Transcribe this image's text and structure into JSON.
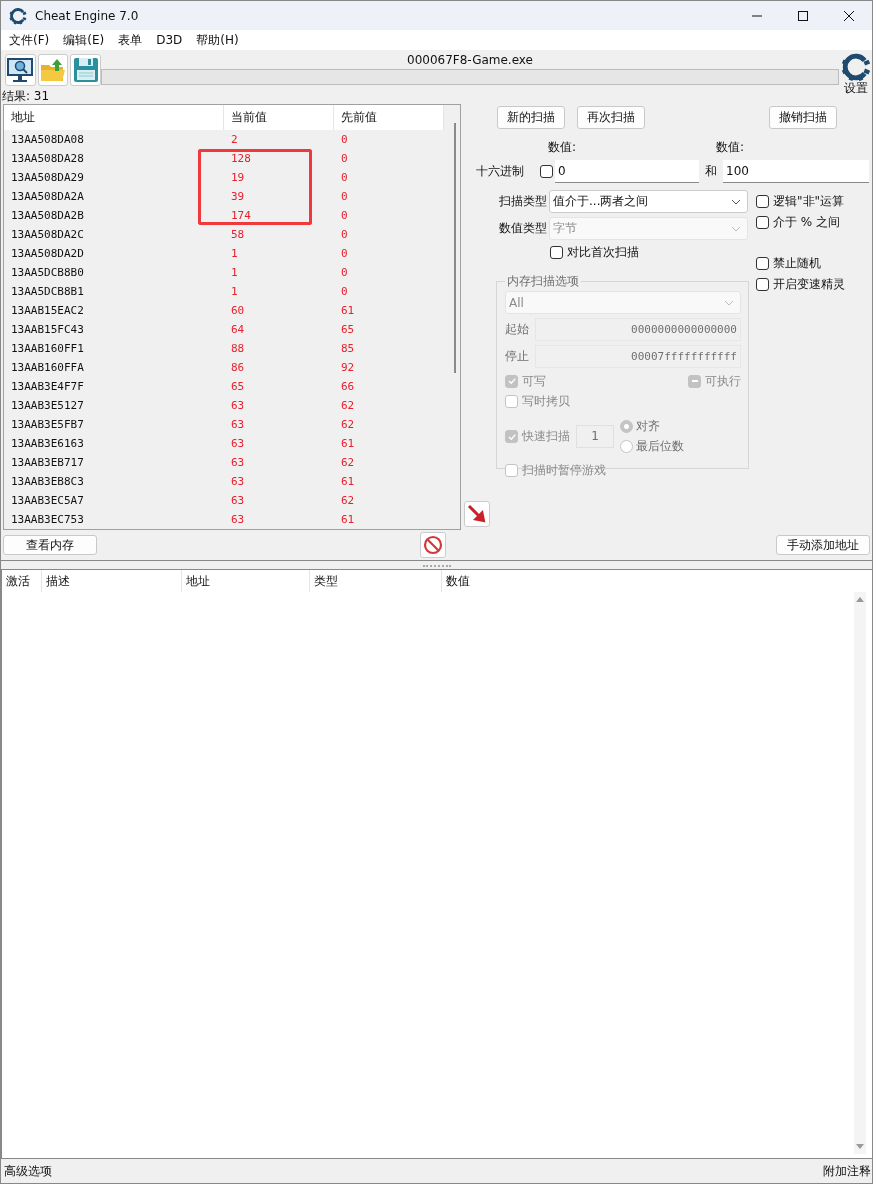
{
  "window": {
    "title": "Cheat Engine 7.0"
  },
  "menu": [
    "文件(F)",
    "编辑(E)",
    "表单",
    "D3D",
    "帮助(H)"
  ],
  "toolbar": {
    "process": "000067F8-Game.exe",
    "progress": {
      "level": 0
    },
    "settings_label": "设置"
  },
  "results_label": "结果: 31",
  "results": {
    "columns": [
      "地址",
      "当前值",
      "先前值"
    ],
    "rows": [
      {
        "address": "13AA508DA08",
        "value": "2",
        "previous": "0",
        "changed": true,
        "highlighted": false
      },
      {
        "address": "13AA508DA28",
        "value": "128",
        "previous": "0",
        "changed": true,
        "highlighted": true
      },
      {
        "address": "13AA508DA29",
        "value": "19",
        "previous": "0",
        "changed": true,
        "highlighted": true
      },
      {
        "address": "13AA508DA2A",
        "value": "39",
        "previous": "0",
        "changed": true,
        "highlighted": true
      },
      {
        "address": "13AA508DA2B",
        "value": "174",
        "previous": "0",
        "changed": true,
        "highlighted": true
      },
      {
        "address": "13AA508DA2C",
        "value": "58",
        "previous": "0",
        "changed": true,
        "highlighted": false
      },
      {
        "address": "13AA508DA2D",
        "value": "1",
        "previous": "0",
        "changed": true,
        "highlighted": false
      },
      {
        "address": "13AA5DCB8B0",
        "value": "1",
        "previous": "0",
        "changed": true,
        "highlighted": false
      },
      {
        "address": "13AA5DCB8B1",
        "value": "1",
        "previous": "0",
        "changed": true,
        "highlighted": false
      },
      {
        "address": "13AAB15EAC2",
        "value": "60",
        "previous": "61",
        "changed": true,
        "highlighted": false
      },
      {
        "address": "13AAB15FC43",
        "value": "64",
        "previous": "65",
        "changed": true,
        "highlighted": false
      },
      {
        "address": "13AAB160FF1",
        "value": "88",
        "previous": "85",
        "changed": true,
        "highlighted": false
      },
      {
        "address": "13AAB160FFA",
        "value": "86",
        "previous": "92",
        "changed": true,
        "highlighted": false
      },
      {
        "address": "13AAB3E4F7F",
        "value": "65",
        "previous": "66",
        "changed": true,
        "highlighted": false
      },
      {
        "address": "13AAB3E5127",
        "value": "63",
        "previous": "62",
        "changed": true,
        "highlighted": false
      },
      {
        "address": "13AAB3E5FB7",
        "value": "63",
        "previous": "62",
        "changed": true,
        "highlighted": false
      },
      {
        "address": "13AAB3E6163",
        "value": "63",
        "previous": "61",
        "changed": true,
        "highlighted": false
      },
      {
        "address": "13AAB3EB717",
        "value": "63",
        "previous": "62",
        "changed": true,
        "highlighted": false
      },
      {
        "address": "13AAB3EB8C3",
        "value": "63",
        "previous": "61",
        "changed": true,
        "highlighted": false
      },
      {
        "address": "13AAB3EC5A7",
        "value": "63",
        "previous": "62",
        "changed": true,
        "highlighted": false
      },
      {
        "address": "13AAB3EC753",
        "value": "63",
        "previous": "61",
        "changed": true,
        "highlighted": false
      }
    ]
  },
  "scan": {
    "buttons": [
      {
        "label": "新的扫描",
        "disabled": false
      },
      {
        "label": "再次扫描",
        "disabled": false
      },
      {
        "label": "撤销扫描",
        "disabled": false
      }
    ],
    "value_labels": [
      "数值:",
      "数值:"
    ],
    "hex": {
      "label": "十六进制",
      "checked": false,
      "disabled": false
    },
    "value_from": "0",
    "and_label": "和",
    "value_to": "100",
    "scan_type": {
      "label": "扫描类型",
      "value": "值介于...两者之间",
      "disabled": false
    },
    "value_type": {
      "label": "数值类型",
      "value": "字节",
      "disabled": true
    },
    "compare_first": {
      "label": "对比首次扫描",
      "checked": false,
      "disabled": false
    },
    "side_options": [
      {
        "label": "逻辑\"非\"运算",
        "checked": false,
        "disabled": false
      },
      {
        "label": "介于 % 之间",
        "checked": false,
        "disabled": false
      },
      {
        "label": "禁止随机",
        "checked": false,
        "disabled": false
      },
      {
        "label": "开启变速精灵",
        "checked": false,
        "disabled": false
      }
    ],
    "memory": {
      "title": "内存扫描选项",
      "region": {
        "value": "All",
        "disabled": true
      },
      "start": {
        "label": "起始",
        "value": "0000000000000000",
        "disabled": true
      },
      "stop": {
        "label": "停止",
        "value": "00007fffffffffff",
        "disabled": true
      },
      "writable": {
        "label": "可写",
        "checked": true,
        "disabled": true
      },
      "executable": {
        "label": "可执行",
        "checked": false,
        "indeterminate": true,
        "disabled": true
      },
      "copy_on_write": {
        "label": "写时拷贝",
        "checked": false,
        "disabled": true
      },
      "fast_scan": {
        "label": "快速扫描",
        "checked": true,
        "disabled": true,
        "value": "1"
      },
      "alignment": [
        {
          "label": "对齐",
          "selected": true
        },
        {
          "label": "最后位数",
          "selected": false
        }
      ],
      "pause": {
        "label": "扫描时暂停游戏",
        "checked": false,
        "disabled": true
      }
    }
  },
  "bottom_buttons": [
    "查看内存",
    "手动添加地址"
  ],
  "address_list": {
    "columns": [
      "激活",
      "描述",
      "地址",
      "类型",
      "数值"
    ]
  },
  "status_bar": {
    "left": "高级选项",
    "right": "附加注释"
  }
}
